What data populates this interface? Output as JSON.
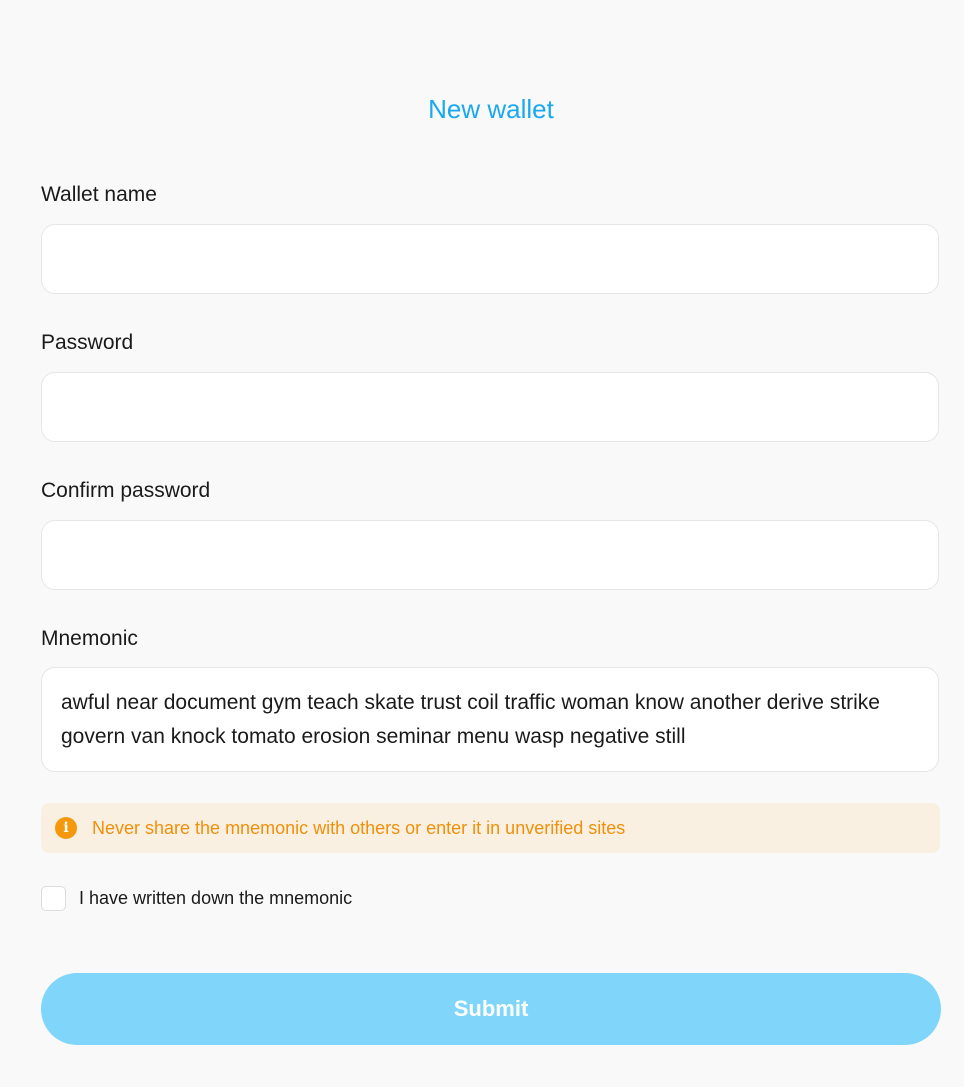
{
  "header": {
    "title": "New wallet"
  },
  "form": {
    "wallet_name": {
      "label": "Wallet name",
      "value": "",
      "placeholder": ""
    },
    "password": {
      "label": "Password",
      "value": "",
      "placeholder": ""
    },
    "confirm_password": {
      "label": "Confirm password",
      "value": "",
      "placeholder": ""
    },
    "mnemonic": {
      "label": "Mnemonic",
      "value": "awful near document gym teach skate trust coil traffic woman know another derive strike govern van knock tomato erosion seminar menu wasp negative still"
    },
    "warning": {
      "icon": "info-icon",
      "icon_glyph": "i",
      "text": "Never share the mnemonic with others or enter it in unverified sites"
    },
    "acknowledge": {
      "label": "I have written down the mnemonic",
      "checked": false
    },
    "submit_label": "Submit"
  },
  "colors": {
    "accent": "#1aa8ee",
    "submit_disabled": "#7fd6fa",
    "warning_bg": "#faf0e2",
    "warning_text": "#f0900a",
    "background": "#f9f9f9"
  }
}
